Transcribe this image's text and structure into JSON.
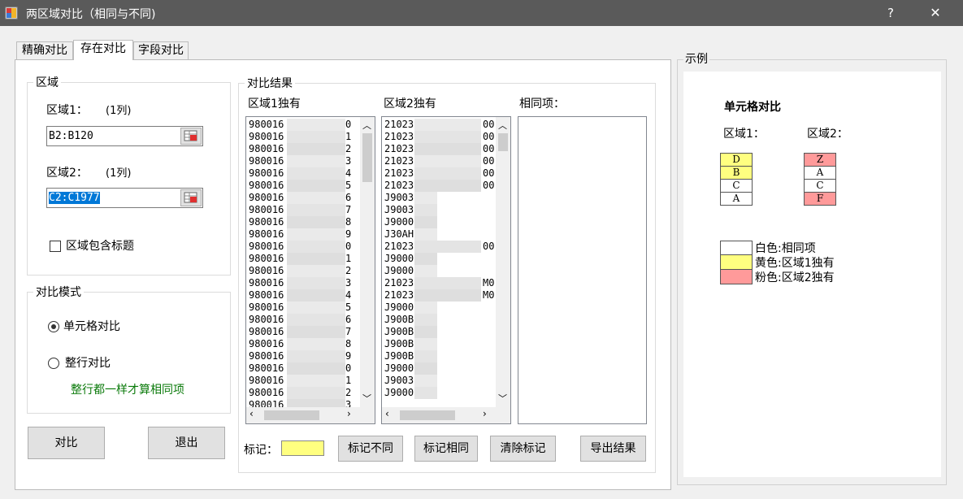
{
  "window": {
    "title": "两区域对比（相同与不同)",
    "help": "?",
    "close": "✕"
  },
  "tabs": [
    {
      "label": "精确对比"
    },
    {
      "label": "存在对比"
    },
    {
      "label": "字段对比"
    }
  ],
  "region": {
    "group_label": "区域",
    "r1_label": "区域1：",
    "r1_cols": "(1列)",
    "r1_value": "B2:B120",
    "r2_label": "区域2：",
    "r2_cols": "(1列)",
    "r2_value": "C2:C1977",
    "header_checkbox": "区域包含标题",
    "header_checked": false
  },
  "mode": {
    "group_label": "对比模式",
    "cell_compare": "单元格对比",
    "row_compare": "整行对比",
    "selected": "cell",
    "hint": "整行都一样才算相同项",
    "hint_color": "#0a7a0a"
  },
  "buttons": {
    "compare": "对比",
    "exit": "退出"
  },
  "results": {
    "group_label": "对比结果",
    "col1_label": "区域1独有",
    "col2_label": "区域2独有",
    "col3_label": "相同项：",
    "list1": [
      "980016",
      "980016",
      "980016",
      "980016",
      "980016",
      "980016",
      "980016",
      "980016",
      "980016",
      "980016",
      "980016",
      "980016",
      "980016",
      "980016",
      "980016",
      "980016",
      "980016",
      "980016",
      "980016",
      "980016",
      "980016",
      "980016",
      "980016",
      "980016"
    ],
    "list1_suffix": [
      "0",
      "1",
      "2",
      "3",
      "4",
      "5",
      "6",
      "7",
      "8",
      "9",
      "0",
      "1",
      "2",
      "3",
      "4",
      "5",
      "6",
      "7",
      "8",
      "9",
      "0",
      "1",
      "2",
      "3"
    ],
    "list2": [
      "21023",
      "21023",
      "21023",
      "21023",
      "21023",
      "21023",
      "J9003",
      "J9003",
      "J9000",
      "J30AH",
      "21023",
      "J9000",
      "J9000",
      "21023",
      "21023",
      "J9000",
      "J900B",
      "J900B",
      "J900B",
      "J900B",
      "J9000",
      "J9003",
      "J9000"
    ],
    "list2_suffix": [
      "00",
      "00",
      "00",
      "00",
      "00",
      "00",
      "",
      "",
      "",
      "",
      "00",
      "",
      "",
      "M0",
      "M0",
      "",
      "",
      "",
      "",
      "",
      "",
      "",
      ""
    ],
    "mark_label": "标记：",
    "mark_color": "#ffff80",
    "mark_diff": "标记不同",
    "mark_same": "标记相同",
    "clear_mark": "清除标记",
    "export": "导出结果"
  },
  "example": {
    "group_label": "示例",
    "title": "单元格对比",
    "r1_label": "区域1：",
    "r2_label": "区域2：",
    "col1": [
      {
        "v": "D",
        "c": "yellow"
      },
      {
        "v": "B",
        "c": "yellow"
      },
      {
        "v": "C",
        "c": "white"
      },
      {
        "v": "A",
        "c": "white"
      }
    ],
    "col2": [
      {
        "v": "Z",
        "c": "pink"
      },
      {
        "v": "A",
        "c": "white"
      },
      {
        "v": "C",
        "c": "white"
      },
      {
        "v": "F",
        "c": "pink"
      }
    ],
    "legend": [
      {
        "c": "white",
        "text": "白色:相同项"
      },
      {
        "c": "yellow",
        "text": "黄色:区域1独有"
      },
      {
        "c": "pink",
        "text": "粉色:区域2独有"
      }
    ]
  }
}
